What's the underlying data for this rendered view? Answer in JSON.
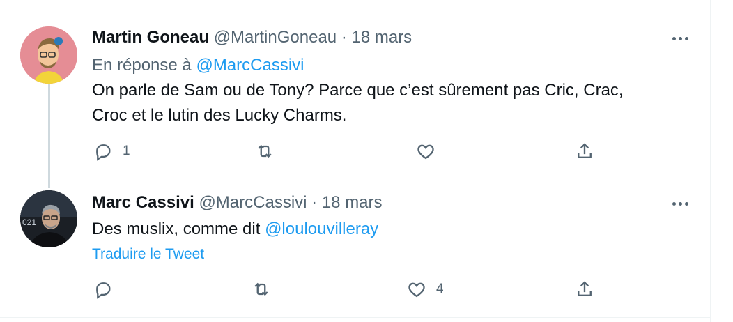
{
  "tweets": [
    {
      "name": "Martin Goneau",
      "handle": "@MartinGoneau",
      "separator": "·",
      "date": "18 mars",
      "reply_prefix": "En réponse à",
      "reply_handle": "@MarcCassivi",
      "text_line1": "On parle de Sam ou de Tony? Parce que c’est sûrement pas Cric, Crac,",
      "text_line2": "Croc et le lutin des Lucky Charms.",
      "reply_count": "1",
      "retweet_count": "",
      "like_count": ""
    },
    {
      "name": "Marc Cassivi",
      "handle": "@MarcCassivi",
      "separator": "·",
      "date": "18 mars",
      "text_prefix": "Des muslix, comme dit",
      "text_mention": "@loulouvilleray",
      "translate_label": "Traduire le Tweet",
      "reply_count": "",
      "retweet_count": "",
      "like_count": "4"
    }
  ],
  "icons": {
    "more": "more-horizontal-icon",
    "reply": "reply-icon",
    "retweet": "retweet-icon",
    "like": "heart-icon",
    "share": "share-icon"
  },
  "colors": {
    "link": "#1d9bf0",
    "secondary": "#536471",
    "thread_line": "#cfd9de"
  }
}
